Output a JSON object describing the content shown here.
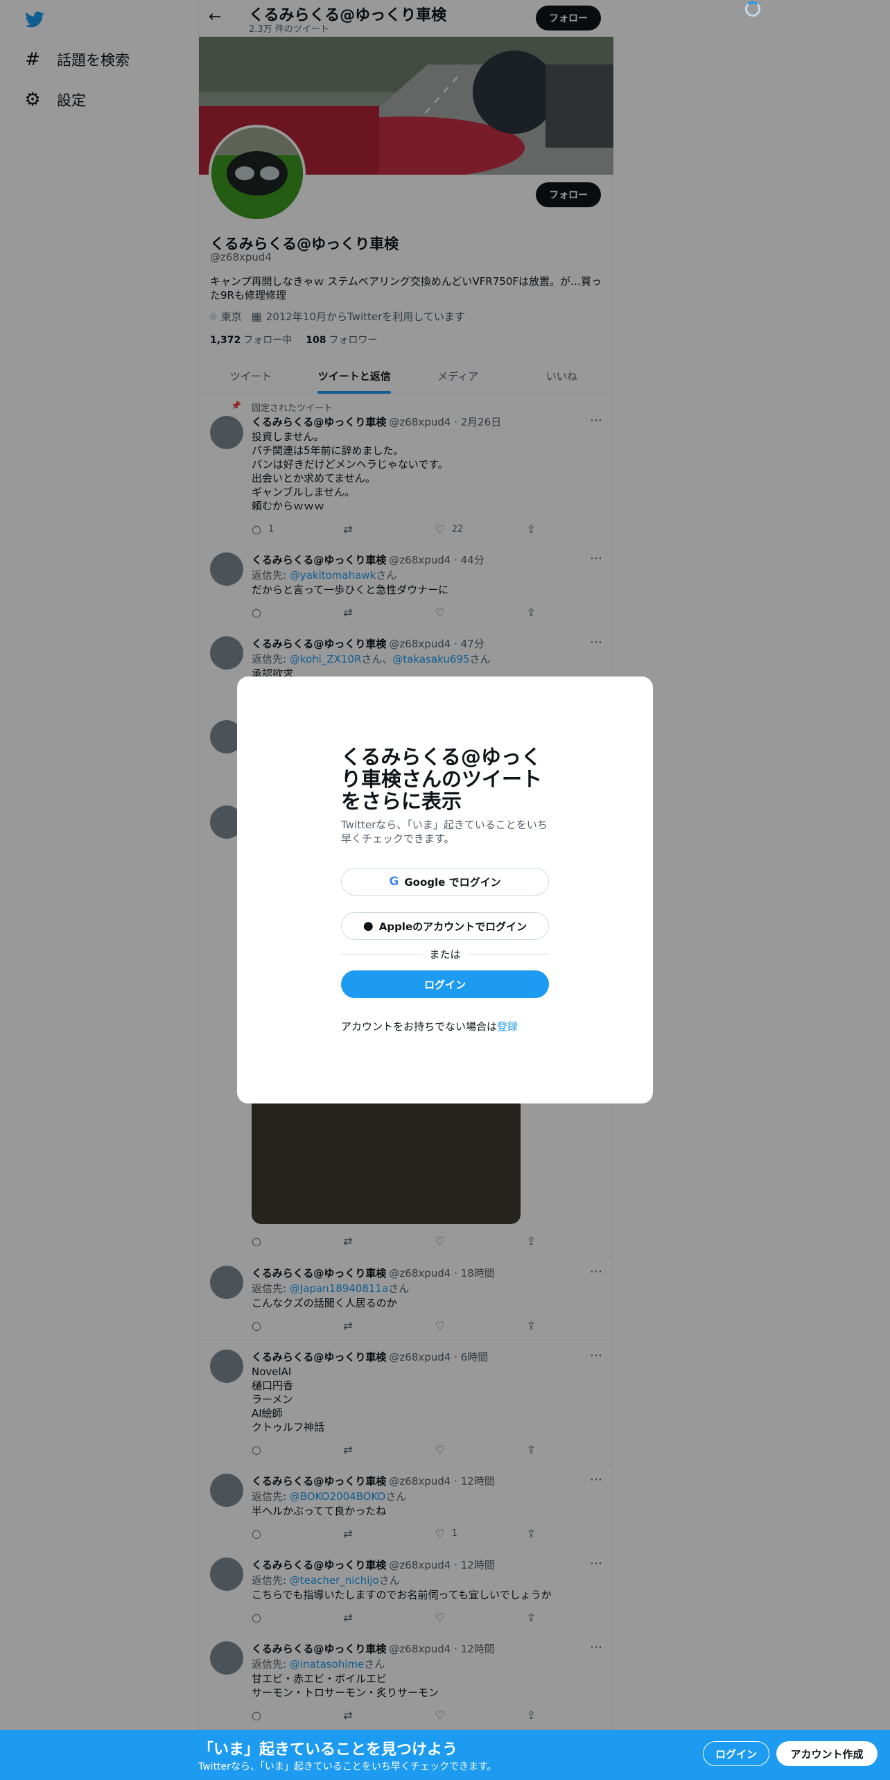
{
  "nav": {
    "items": [
      {
        "icon": "hashtag-icon",
        "label": "話題を検索"
      },
      {
        "icon": "gear-icon",
        "label": "設定"
      }
    ]
  },
  "header": {
    "title": "くるみらくる@ゆっくり車検",
    "tweet_count": "2.3万 件のツイート",
    "follow_label": "フォロー"
  },
  "profile": {
    "name": "くるみらくる@ゆっくり車検",
    "handle": "@z68xpud4",
    "bio": "キャンプ再開しなきゃｗ ステムベアリング交換めんどいVFR750Fは放置。が…買った9Rも修理修理",
    "location": "東京",
    "joined": "2012年10月からTwitterを利用しています",
    "following_count": "1,372",
    "following_label": "フォロー中",
    "followers_count": "108",
    "followers_label": "フォロワー",
    "follow_label": "フォロー"
  },
  "tabs": [
    "ツイート",
    "ツイートと返信",
    "メディア",
    "いいね"
  ],
  "tweets": [
    {
      "pinned_label": "固定されたツイート",
      "name": "くるみらくる@ゆっくり車検",
      "meta": "@z68xpud4 · 2月26日",
      "body": "投資しません。\nパチ関連は5年前に辞めました。\nパンは好きだけどメンヘラじゃないです。\n出会いとか求めてません。\nギャンブルしません。\n頼むからｗｗｗ",
      "replies": "1",
      "retweets": "",
      "likes": "22"
    },
    {
      "name": "くるみらくる@ゆっくり車検",
      "meta": "@z68xpud4 · 44分",
      "reply_prefix": "返信先: ",
      "reply_to": "@yakitomahawk",
      "reply_suffix": "さん",
      "body": "だからと言って一歩ひくと急性ダウナーに",
      "replies": "",
      "retweets": "",
      "likes": ""
    },
    {
      "name": "くるみらくる@ゆっくり車検",
      "meta": "@z68xpud4 · 47分",
      "reply_prefix": "返信先: ",
      "reply_to": "@kohi_ZX10R",
      "reply_mid": "さん、",
      "reply_to2": "@takasaku695",
      "reply_suffix": "さん",
      "body": "承認欲求"
    },
    {
      "name": "くるみらくる@ゆっくり車検",
      "meta": "@z68xpud4 · 18時間",
      "reply_prefix": "返信先: ",
      "reply_to": "@Japan18940811a",
      "reply_suffix": "さん",
      "body": "こんなクズの話聞く人居るのか",
      "replies": "",
      "retweets": "",
      "likes": ""
    },
    {
      "name": "くるみらくる@ゆっくり車検",
      "meta": "@z68xpud4 · 6時間",
      "body": "NovelAI\n樋口円香\nラーメン\nAI絵師\nクトゥルフ神話",
      "replies": "",
      "retweets": "",
      "likes": ""
    },
    {
      "name": "くるみらくる@ゆっくり車検",
      "meta": "@z68xpud4 · 12時間",
      "reply_prefix": "返信先: ",
      "reply_to": "@BOKO2004BOKO",
      "reply_suffix": "さん",
      "body": "半ヘルかぶってて良かったね",
      "replies": "",
      "retweets": "",
      "likes": "1"
    },
    {
      "name": "くるみらくる@ゆっくり車検",
      "meta": "@z68xpud4 · 12時間",
      "reply_prefix": "返信先: ",
      "reply_to": "@teacher_nichijo",
      "reply_suffix": "さん",
      "body": "こちらでも指導いたしますのでお名前伺っても宜しいでしょうか",
      "replies": "",
      "retweets": "",
      "likes": ""
    },
    {
      "name": "くるみらくる@ゆっくり車検",
      "meta": "@z68xpud4 · 12時間",
      "reply_prefix": "返信先: ",
      "reply_to": "@inatasohime",
      "reply_suffix": "さん",
      "body": "甘エビ・赤エビ・ボイルエビ\nサーモン・トロサーモン・炙りサーモン",
      "replies": "",
      "retweets": "",
      "likes": ""
    }
  ],
  "modal": {
    "title": "くるみらくる@ゆっくり車検さんのツイートをさらに表示",
    "subtitle": "Twitterなら、「いま」起きていることをいち早くチェックできます。",
    "google_label": "Google でログイン",
    "apple_label": "Appleのアカウントでログイン",
    "or_label": "または",
    "login_label": "ログイン",
    "signup_text": "アカウントをお持ちでない場合は",
    "signup_link": "登録"
  },
  "bottom_bar": {
    "title": "「いま」起きていることを見つけよう",
    "subtitle": "Twitterなら、「いま」起きていることをいち早くチェックできます。",
    "login_label": "ログイン",
    "signup_label": "アカウント作成"
  },
  "colors": {
    "accent": "#1d9bf0",
    "text": "#0f1419",
    "muted": "#536471"
  }
}
